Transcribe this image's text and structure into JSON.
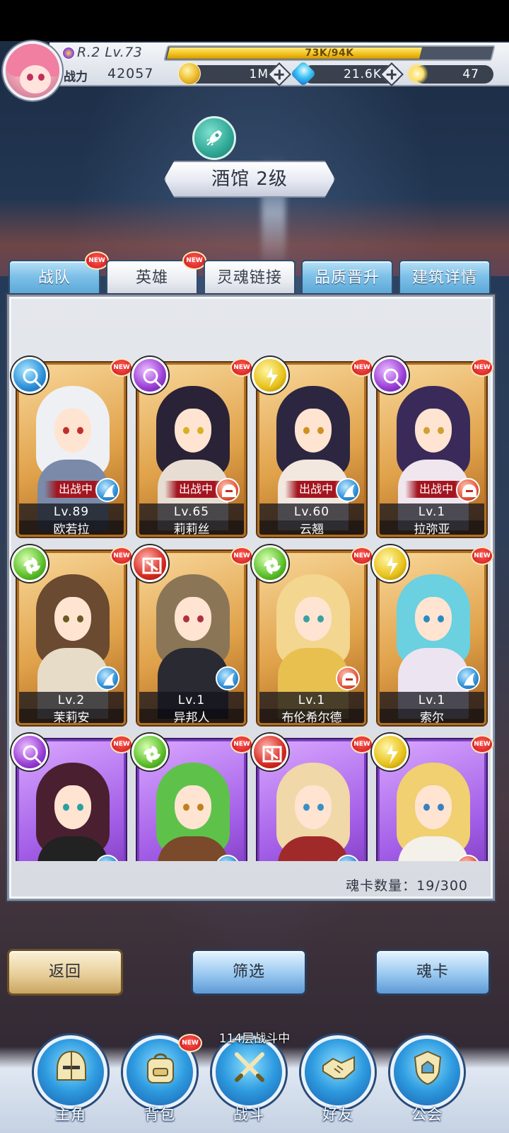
{
  "player": {
    "rank_level": "R.2 Lv.73",
    "exp_text": "73K/94K",
    "exp_fraction": 0.777,
    "power_label": "战力",
    "power_value": "42057"
  },
  "resources": {
    "gold": "1M",
    "gems": "21.6K",
    "stars": "47"
  },
  "building": {
    "title": "酒馆 2级",
    "icon": "rocket-icon"
  },
  "tabs": [
    {
      "label": "战队",
      "new": "NEW",
      "active": false
    },
    {
      "label": "英雄",
      "new": "NEW",
      "active": true
    },
    {
      "label": "灵魂链接",
      "active": true
    },
    {
      "label": "品质晋升",
      "active": false
    },
    {
      "label": "建筑详情",
      "active": false
    }
  ],
  "heroes": [
    {
      "name": "欧若拉",
      "level": "Lv.89",
      "in_battle": "出战中",
      "element": "blue",
      "role": "blue",
      "new": "NEW",
      "frame": "gold"
    },
    {
      "name": "莉莉丝",
      "level": "Lv.65",
      "in_battle": "出战中",
      "element": "purple",
      "role": "red",
      "new": "NEW",
      "frame": "gold"
    },
    {
      "name": "云翘",
      "level": "Lv.60",
      "in_battle": "出战中",
      "element": "yellow",
      "role": "blue",
      "new": "NEW",
      "frame": "gold"
    },
    {
      "name": "拉弥亚",
      "level": "Lv.1",
      "in_battle": "出战中",
      "element": "purple",
      "role": "red",
      "new": "NEW",
      "frame": "gold"
    },
    {
      "name": "茉莉安",
      "level": "Lv.2",
      "element": "green",
      "role": "blue",
      "new": "NEW",
      "frame": "gold"
    },
    {
      "name": "异邦人",
      "level": "Lv.1",
      "element": "red",
      "role": "blue",
      "new": "NEW",
      "frame": "gold"
    },
    {
      "name": "布伦希尔德",
      "level": "Lv.1",
      "element": "green",
      "role": "red",
      "new": "NEW",
      "frame": "gold"
    },
    {
      "name": "索尔",
      "level": "Lv.1",
      "element": "yellow",
      "role": "blue",
      "new": "NEW",
      "frame": "gold"
    },
    {
      "element": "purple",
      "role": "blue",
      "new": "NEW",
      "frame": "purple"
    },
    {
      "element": "green",
      "role": "blue",
      "new": "NEW",
      "frame": "purple"
    },
    {
      "element": "red",
      "role": "blue",
      "new": "NEW",
      "frame": "purple"
    },
    {
      "element": "yellow",
      "role": "red",
      "new": "NEW",
      "frame": "purple"
    }
  ],
  "card_count": "魂卡数量：19/300",
  "buttons": {
    "back": "返回",
    "filter": "筛选",
    "soul_card": "魂卡"
  },
  "floor_status": "114层战斗中",
  "nav": [
    {
      "label": "主角",
      "icon": "knight-helmet-icon"
    },
    {
      "label": "背包",
      "icon": "backpack-icon",
      "new": "NEW"
    },
    {
      "label": "战斗",
      "icon": "crossed-swords-icon"
    },
    {
      "label": "好友",
      "icon": "handshake-icon"
    },
    {
      "label": "公会",
      "icon": "guild-emblem-icon"
    }
  ],
  "colors": {
    "gold_frame": "#b07024",
    "purple_frame": "#7b3fbf",
    "tab_blue": "#7cc0e8",
    "new_red": "#d62a22"
  }
}
